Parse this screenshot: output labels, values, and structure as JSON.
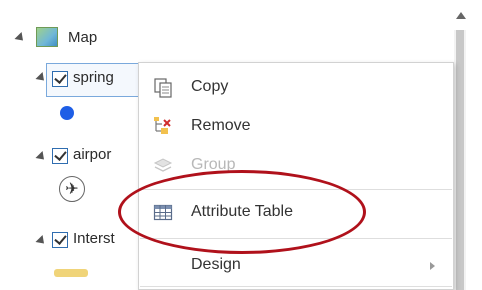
{
  "tree": {
    "map_label": "Map",
    "layers": [
      {
        "name": "spring",
        "checked": true,
        "symbol": "blue-point"
      },
      {
        "name": "airpor",
        "checked": true,
        "symbol": "airplane"
      },
      {
        "name": "Interst",
        "checked": true,
        "symbol": "yellow-line"
      }
    ]
  },
  "context_menu": {
    "items": [
      {
        "label": "Copy",
        "icon": "copy-icon",
        "enabled": true
      },
      {
        "label": "Remove",
        "icon": "remove-icon",
        "enabled": true
      },
      {
        "label": "Group",
        "icon": "group-icon",
        "enabled": false
      },
      {
        "label": "Attribute Table",
        "icon": "table-icon",
        "enabled": true,
        "highlighted": true
      },
      {
        "label": "Design",
        "enabled": true,
        "submenu": true
      }
    ]
  },
  "colors": {
    "highlight_ellipse": "#b0111b",
    "point_symbol": "#1e5ee6",
    "line_symbol": "#f0d479",
    "selection_border": "#7aa9dc"
  }
}
